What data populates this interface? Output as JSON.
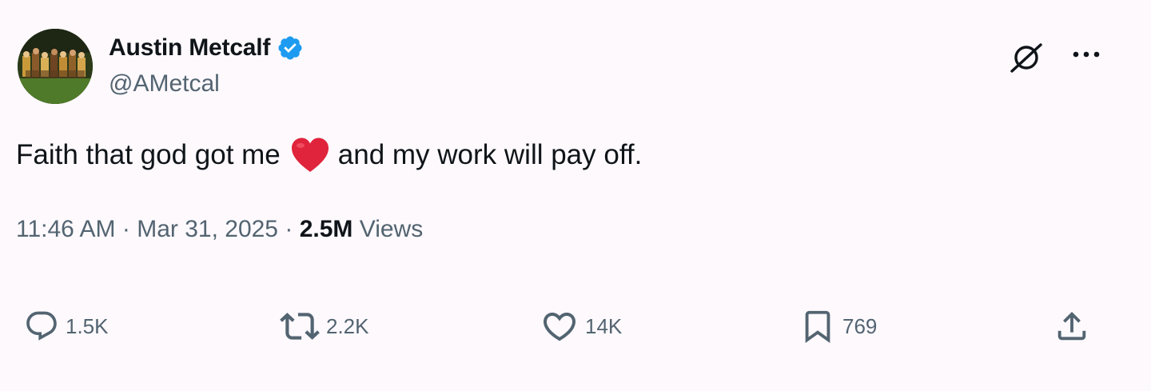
{
  "author": {
    "display_name": "Austin Metcalf",
    "handle": "@AMetcal",
    "verified": true
  },
  "tweet": {
    "text_before": "Faith that god got me",
    "text_after": "and my work will pay off.",
    "emoji": "red-heart"
  },
  "meta": {
    "time": "11:46 AM",
    "separator": "·",
    "date": "Mar 31, 2025",
    "views_count": "2.5M",
    "views_label": "Views"
  },
  "actions": {
    "replies": "1.5K",
    "reposts": "2.2K",
    "likes": "14K",
    "bookmarks": "769"
  },
  "colors": {
    "text_primary": "#0f1419",
    "text_secondary": "#536471",
    "verified_blue": "#1d9bf0",
    "heart_red": "#e0243b",
    "background": "#fdf9fd"
  },
  "icons": {
    "verified": "verified-badge-icon",
    "grok": "grok-icon",
    "more": "more-horizontal-icon",
    "reply": "reply-icon",
    "repost": "repost-icon",
    "like": "heart-icon",
    "bookmark": "bookmark-icon",
    "share": "share-icon"
  }
}
